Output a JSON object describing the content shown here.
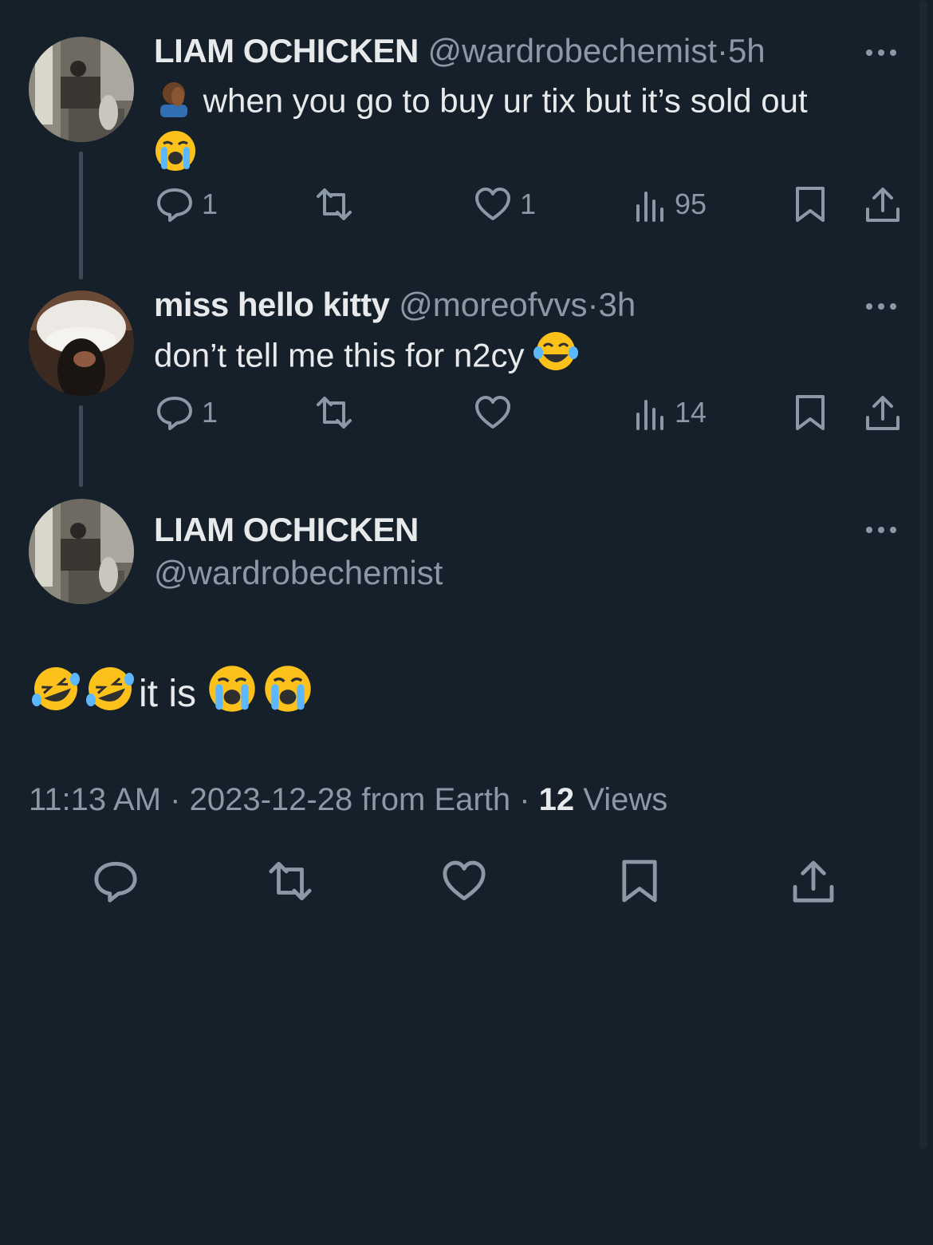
{
  "colors": {
    "background": "#15202b",
    "text": "#e7e9ea",
    "muted": "#8b98a5",
    "thread_line": "#3e4a57"
  },
  "tweets": [
    {
      "name": "LIAM OCHICKEN",
      "handle": "@wardrobechemist",
      "sep": "·",
      "time": "5h",
      "text": "when you go to buy ur tix but it’s sold out",
      "emoji_start": "man-facepalming",
      "emoji_end": "loudly-crying-face",
      "replies": "1",
      "likes": "1",
      "views": "95"
    },
    {
      "name": "miss hello kitty",
      "handle": "@moreofvvs",
      "sep": "·",
      "time": "3h",
      "text": "don’t tell me this for n2cy",
      "emoji_end": "face-with-tears-of-joy",
      "replies": "1",
      "views": "14"
    }
  ],
  "main_tweet": {
    "name": "LIAM OCHICKEN",
    "handle": "@wardrobechemist",
    "text": "it is",
    "emojis": [
      "rolling-on-the-floor-laughing",
      "rolling-on-the-floor-laughing",
      "loudly-crying-face",
      "loudly-crying-face"
    ],
    "time": "11:13 AM",
    "sep": "·",
    "date": "2023-12-28",
    "source": "from Earth",
    "views_count": "12",
    "views_label": "Views"
  }
}
